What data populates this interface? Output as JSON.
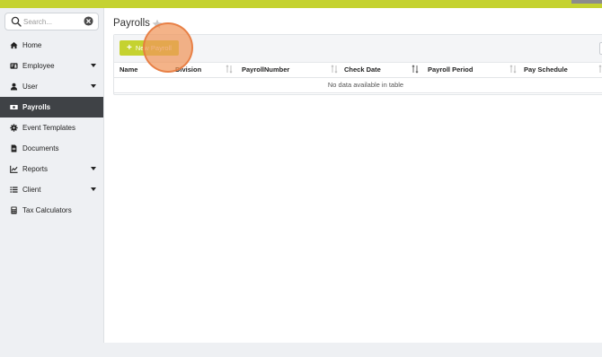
{
  "search": {
    "placeholder": "Search..."
  },
  "sidebar": {
    "items": [
      {
        "label": "Home",
        "icon": "home-icon",
        "has_caret": false,
        "active": false
      },
      {
        "label": "Employee",
        "icon": "id-card-icon",
        "has_caret": true,
        "active": false
      },
      {
        "label": "User",
        "icon": "user-icon",
        "has_caret": true,
        "active": false
      },
      {
        "label": "Payrolls",
        "icon": "money-bill-icon",
        "has_caret": false,
        "active": true
      },
      {
        "label": "Event Templates",
        "icon": "gear-icon",
        "has_caret": false,
        "active": false
      },
      {
        "label": "Documents",
        "icon": "document-icon",
        "has_caret": false,
        "active": false
      },
      {
        "label": "Reports",
        "icon": "line-chart-icon",
        "has_caret": true,
        "active": false
      },
      {
        "label": "Client",
        "icon": "list-icon",
        "has_caret": true,
        "active": false
      },
      {
        "label": "Tax Calculators",
        "icon": "calculator-icon",
        "has_caret": false,
        "active": false
      }
    ]
  },
  "page": {
    "title": "Payrolls",
    "new_button_label": "New Payroll"
  },
  "table": {
    "columns": [
      "Name",
      "Division",
      "PayrollNumber",
      "Check Date",
      "Payroll Period",
      "Pay Schedule"
    ],
    "empty_message": "No data available in table"
  },
  "colors": {
    "accent": "#c5d230",
    "sidebar_active": "#3f4246",
    "cursor_highlight": "#f0965a"
  }
}
